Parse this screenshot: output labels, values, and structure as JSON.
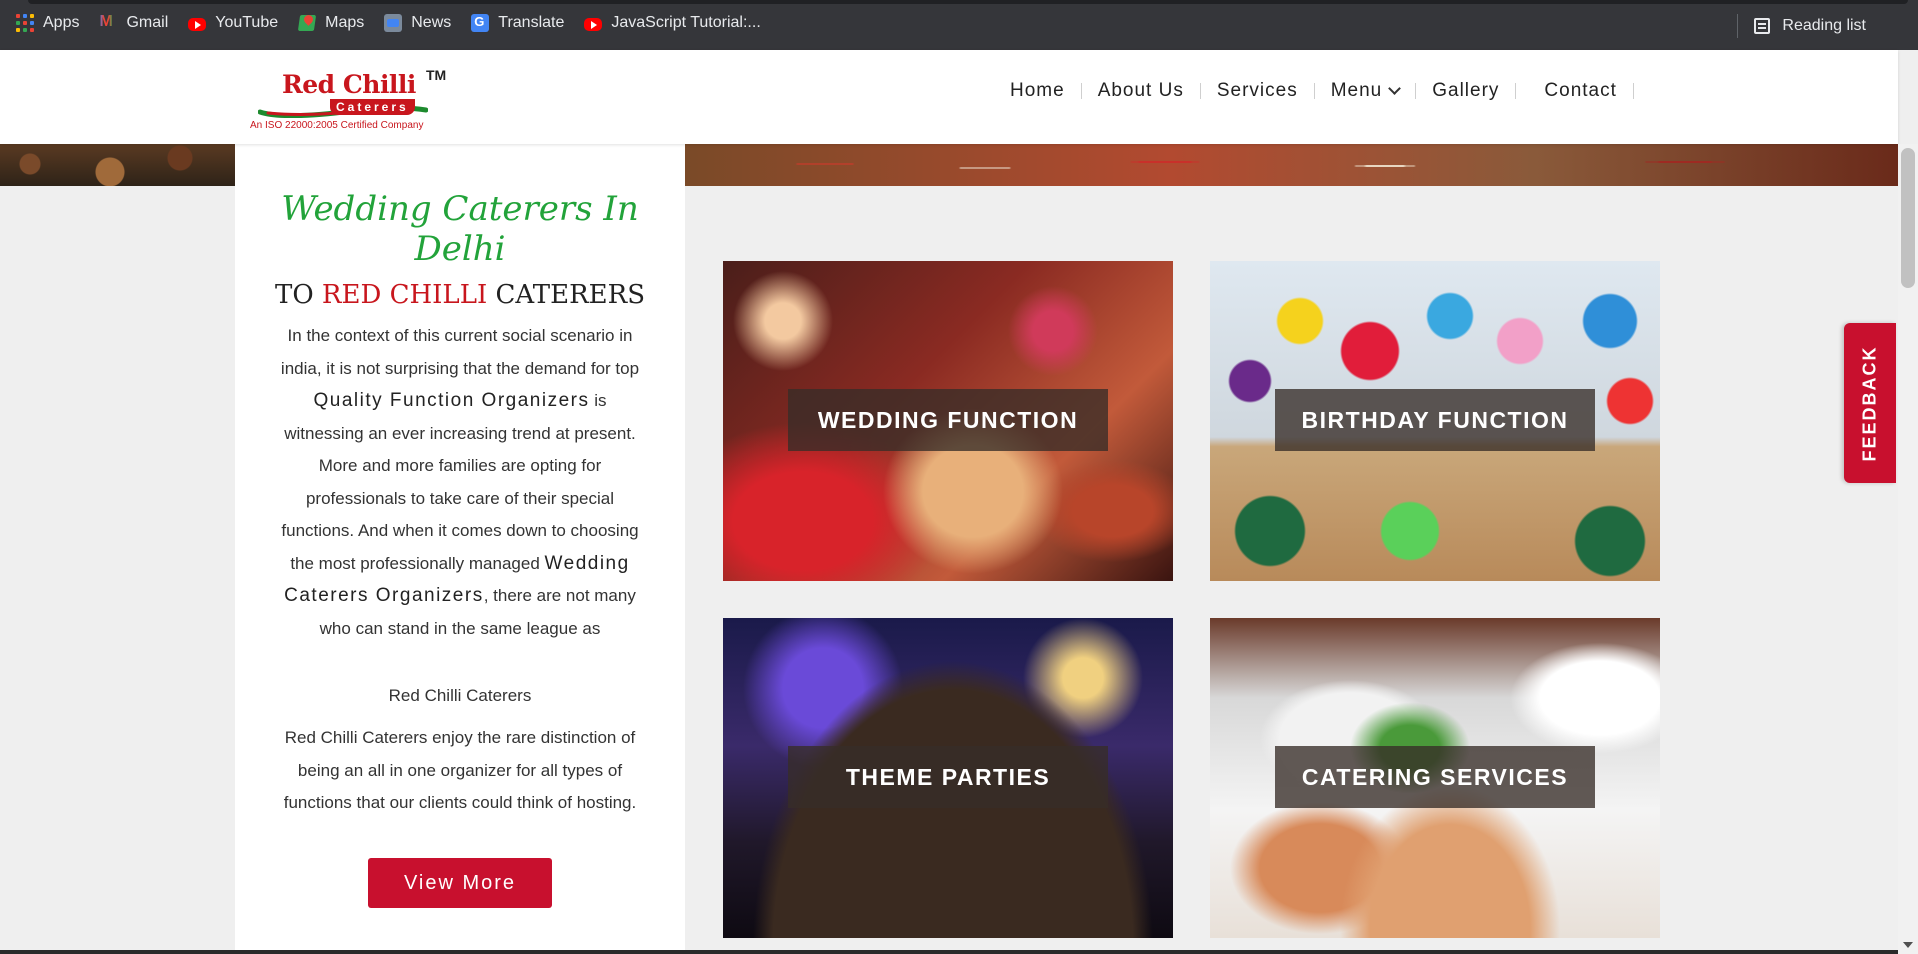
{
  "bookmarks": {
    "items": [
      {
        "label": "Apps",
        "icon": "apps-grid-icon"
      },
      {
        "label": "Gmail",
        "icon": "gmail-icon"
      },
      {
        "label": "YouTube",
        "icon": "youtube-icon"
      },
      {
        "label": "Maps",
        "icon": "maps-icon"
      },
      {
        "label": "News",
        "icon": "news-icon"
      },
      {
        "label": "Translate",
        "icon": "translate-icon"
      },
      {
        "label": "JavaScript Tutorial:...",
        "icon": "youtube-icon"
      }
    ],
    "reading_list": "Reading list"
  },
  "logo": {
    "name": "Red Chilli",
    "tm": "TM",
    "sub": "Caterers",
    "cert": "An ISO 22000:2005 Certified Company"
  },
  "nav": {
    "home": "Home",
    "about": "About Us",
    "services": "Services",
    "menu": "Menu",
    "gallery": "Gallery",
    "contact": "Contact"
  },
  "intro": {
    "title": "Wedding Caterers In Delhi",
    "sub_to": "TO",
    "sub_brand": "RED CHILLI",
    "sub_rest": "CATERERS",
    "p1_a": "In the context of this current social scenario in india, it is not surprising that the demand for top",
    "p1_em": "Quality Function Organizers",
    "p1_b": "is witnessing an ever increasing trend at present. More and more families are opting for professionals to take care of their special functions. And when it comes down to choosing the most professionally managed",
    "p1_em2": "Wedding Caterers Organizers",
    "p1_c": ", there are not many who can stand in the same league as",
    "name": "Red Chilli Caterers",
    "p2": "Red Chilli Caterers enjoy the rare distinction of being an all in one organizer for all types of functions that our clients could think of hosting.",
    "button": "View More"
  },
  "tiles": [
    {
      "label": "WEDDING FUNCTION"
    },
    {
      "label": "BIRTHDAY FUNCTION"
    },
    {
      "label": "THEME PARTIES"
    },
    {
      "label": "CATERING SERVICES"
    }
  ],
  "feedback": "FEEDBACK",
  "colors": {
    "brand_red": "#c8102e",
    "title_green": "#22a33a",
    "page_bg": "#efefef"
  }
}
